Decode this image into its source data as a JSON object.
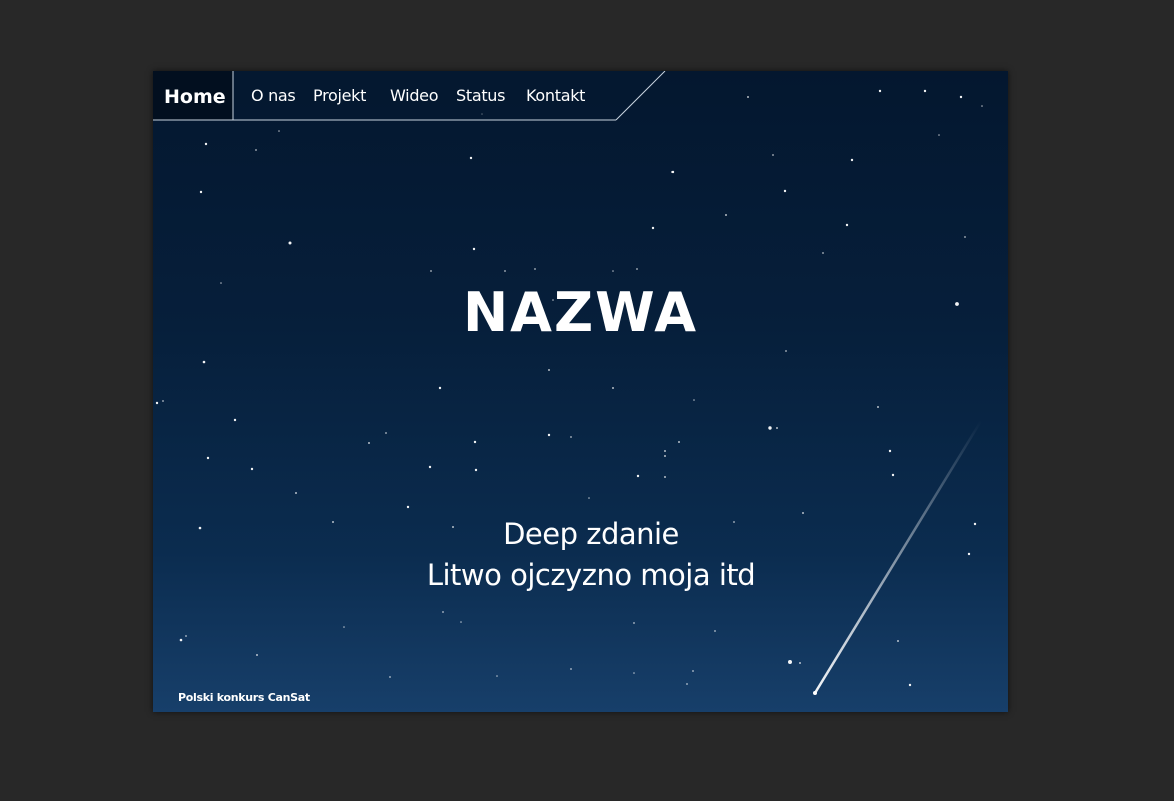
{
  "nav": {
    "home": "Home",
    "items": [
      "O nas",
      "Projekt",
      "Wideo",
      "Status",
      "Kontakt"
    ]
  },
  "hero": {
    "title": "NAZWA",
    "tagline_line1": "Deep zdanie",
    "tagline_line2": "Litwo ojczyzno moja itd"
  },
  "footer": {
    "text": "Polski konkurs CanSat"
  },
  "colors": {
    "background": "#282828",
    "sky_top": "#04172f",
    "sky_bottom": "#173f6a",
    "text": "#ffffff"
  }
}
